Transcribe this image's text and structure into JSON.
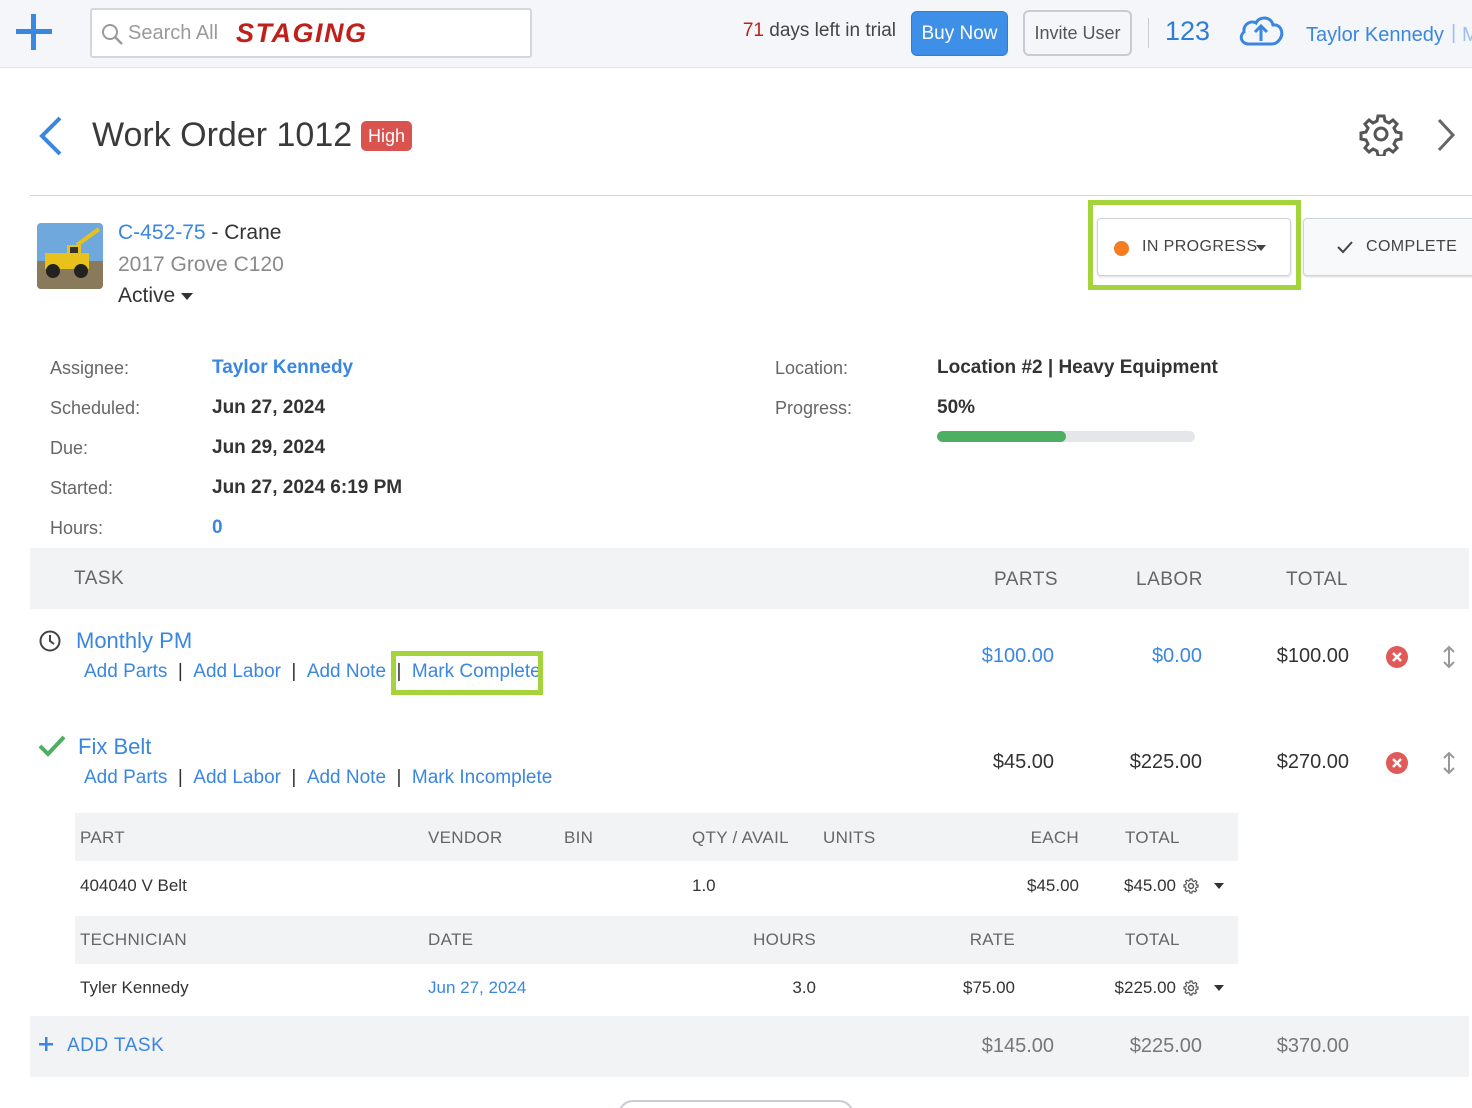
{
  "topbar": {
    "search_placeholder": "Search All",
    "environment": "STAGING",
    "trial_days": "71",
    "trial_text": "days left in trial",
    "buy_label": "Buy Now",
    "invite_label": "Invite User",
    "count": "123",
    "user_name": "Taylor Kennedy",
    "user_sep": "|",
    "user_more": "M"
  },
  "header": {
    "title": "Work Order 1012",
    "priority": "High"
  },
  "asset": {
    "id": "C-452-75",
    "dash": " - ",
    "type": "Crane",
    "model": "2017 Grove C120",
    "status": "Active"
  },
  "status_controls": {
    "current": "IN PROGRESS",
    "complete_label": "COMPLETE",
    "status_color": "#f57c1f"
  },
  "details": {
    "assignee_label": "Assignee:",
    "assignee": "Taylor Kennedy",
    "scheduled_label": "Scheduled:",
    "scheduled": "Jun 27, 2024",
    "due_label": "Due:",
    "due": "Jun 29, 2024",
    "started_label": "Started:",
    "started": "Jun 27, 2024 6:19 PM",
    "hours_label": "Hours:",
    "hours": "0",
    "location_label": "Location:",
    "location": "Location #2 | Heavy Equipment",
    "progress_label": "Progress:",
    "progress": "50%",
    "progress_fraction": 0.5
  },
  "task_table": {
    "headers": {
      "task": "TASK",
      "parts": "PARTS",
      "labor": "LABOR",
      "total": "TOTAL"
    },
    "tasks": [
      {
        "name": "Monthly PM",
        "status_icon": "clock-icon",
        "actions": [
          "Add Parts",
          "Add Labor",
          "Add Note",
          "Mark Complete"
        ],
        "parts": "$100.00",
        "labor": "$0.00",
        "total": "$100.00"
      },
      {
        "name": "Fix Belt",
        "status_icon": "check-icon",
        "actions": [
          "Add Parts",
          "Add Labor",
          "Add Note",
          "Mark Incomplete"
        ],
        "parts": "$45.00",
        "labor": "$225.00",
        "total": "$270.00"
      }
    ],
    "separator": "|",
    "parts_table": {
      "headers": {
        "part": "PART",
        "vendor": "VENDOR",
        "bin": "BIN",
        "qty": "QTY / AVAIL",
        "units": "UNITS",
        "each": "EACH",
        "total": "TOTAL"
      },
      "row": {
        "part": "404040 V Belt",
        "vendor": "",
        "bin": "",
        "qty": "1.0",
        "units": "",
        "each": "$45.00",
        "total": "$45.00"
      }
    },
    "labor_table": {
      "headers": {
        "technician": "TECHNICIAN",
        "date": "DATE",
        "hours": "HOURS",
        "rate": "RATE",
        "total": "TOTAL"
      },
      "row": {
        "technician": "Tyler Kennedy",
        "date": "Jun 27, 2024",
        "hours": "3.0",
        "rate": "$75.00",
        "total": "$225.00"
      }
    },
    "add_task_label": "ADD TASK",
    "totals": {
      "parts": "$145.00",
      "labor": "$225.00",
      "total": "$370.00"
    }
  },
  "colors": {
    "accent": "#3a86e0",
    "highlight": "#a4d33b",
    "priority": "#d9534f",
    "progress": "#4caf62",
    "danger": "#e15a5a"
  }
}
